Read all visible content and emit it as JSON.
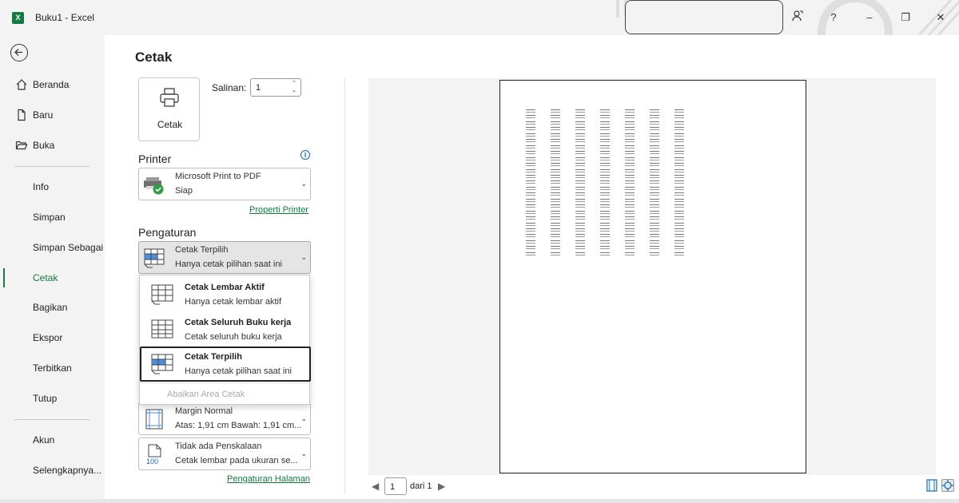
{
  "window": {
    "title": "Buku1  -  Excel",
    "app_icon_letter": "X",
    "accent": "#107c41",
    "controls": {
      "help": "?",
      "minimize": "–",
      "restore": "❐",
      "close": "✕"
    }
  },
  "nav": {
    "items": [
      {
        "label": "Beranda",
        "icon": "home-icon"
      },
      {
        "label": "Baru",
        "icon": "new-file-icon"
      },
      {
        "label": "Buka",
        "icon": "folder-open-icon"
      },
      {
        "label": "Info"
      },
      {
        "label": "Simpan"
      },
      {
        "label": "Simpan Sebagai"
      },
      {
        "label": "Cetak"
      },
      {
        "label": "Bagikan"
      },
      {
        "label": "Ekspor"
      },
      {
        "label": "Terbitkan"
      },
      {
        "label": "Tutup"
      },
      {
        "label": "Akun"
      },
      {
        "label": "Selengkapnya..."
      }
    ],
    "active": "Cetak"
  },
  "print": {
    "page_title": "Cetak",
    "print_button": "Cetak",
    "copies_label": "Salinan:",
    "copies_value": "1",
    "printer_heading": "Printer",
    "printer_name": "Microsoft Print to PDF",
    "printer_status": "Siap",
    "printer_properties_link": "Properti Printer",
    "settings_heading": "Pengaturan",
    "selected_setting": {
      "title": "Cetak Terpilih",
      "subtitle": "Hanya cetak pilihan saat ini"
    },
    "menu": {
      "options": [
        {
          "title": "Cetak Lembar Aktif",
          "subtitle": "Hanya cetak lembar aktif"
        },
        {
          "title": "Cetak Seluruh Buku kerja",
          "subtitle": "Cetak seluruh buku kerja"
        },
        {
          "title": "Cetak Terpilih",
          "subtitle": "Hanya cetak pilihan saat ini"
        }
      ],
      "disabled_option": "Abaikan Area Cetak"
    },
    "margins": {
      "title": "Margin Normal",
      "subtitle": "Atas: 1,91 cm Bawah: 1,91 cm..."
    },
    "scaling": {
      "title": "Tidak ada Penskalaan",
      "subtitle": "Cetak lembar pada ukuran se...",
      "icon_text": "100"
    },
    "page_setup_link": "Pengaturan Halaman"
  },
  "preview": {
    "page_number": "1",
    "of_label": "dari 1",
    "prev_arrow": "◀",
    "next_arrow": "▶",
    "cell_columns": 7,
    "cell_rows": 25
  }
}
